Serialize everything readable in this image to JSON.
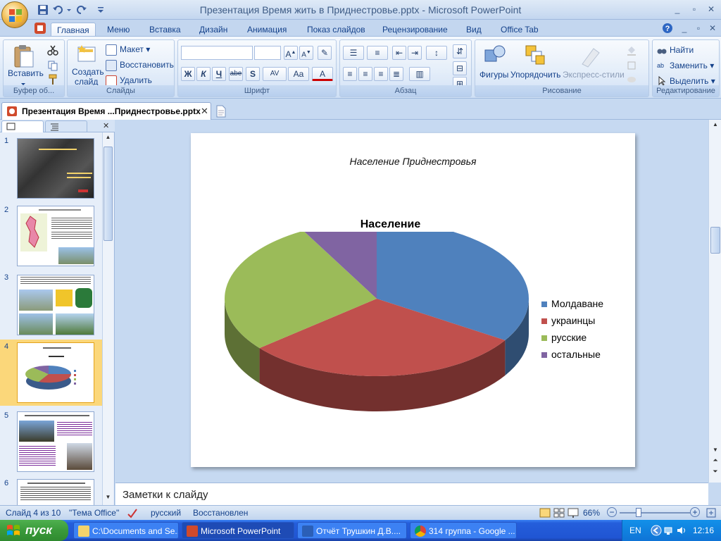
{
  "window": {
    "title": "Презентация  Время жить в Приднестровье.pptx - Microsoft PowerPoint",
    "controls": [
      "_",
      "▫",
      "✕"
    ]
  },
  "ribbon": {
    "tabs": [
      "Главная",
      "Меню",
      "Вставка",
      "Дизайн",
      "Анимация",
      "Показ слайдов",
      "Рецензирование",
      "Вид",
      "Office Tab"
    ],
    "active_tab": 0,
    "clipboard": {
      "paste": "Вставить",
      "label": "Буфер об..."
    },
    "slides": {
      "create": "Создать",
      "create2": "слайд",
      "layout": "Макет",
      "reset": "Восстановить",
      "delete": "Удалить",
      "label": "Слайды"
    },
    "font": {
      "label": "Шрифт",
      "bold": "Ж",
      "italic": "К",
      "underline": "Ч",
      "strike": "abe",
      "shadow": "S",
      "spacing": "AV",
      "case": "Aa",
      "color": "A",
      "grow": "A",
      "shrink": "A"
    },
    "paragraph": {
      "label": "Абзац"
    },
    "drawing": {
      "shapes": "Фигуры",
      "arrange": "Упорядочить",
      "styles": "Экспресс-стили",
      "label": "Рисование"
    },
    "editing": {
      "find": "Найти",
      "replace": "Заменить",
      "select": "Выделить",
      "label": "Редактирование"
    }
  },
  "document_tab": {
    "title": "Презентация  Время ...Приднестровье.pptx"
  },
  "thumbnails": [
    {
      "num": "1"
    },
    {
      "num": "2"
    },
    {
      "num": "3"
    },
    {
      "num": "4"
    },
    {
      "num": "5"
    },
    {
      "num": "6"
    }
  ],
  "slide": {
    "heading": "Население Приднестровья",
    "chart_title": "Население"
  },
  "chart_data": {
    "type": "pie",
    "title": "Население",
    "categories": [
      "Молдаване",
      "украинцы",
      "русские",
      "остальные"
    ],
    "values": [
      34,
      30,
      28,
      8
    ],
    "colors": [
      "#4f81bd",
      "#c0504d",
      "#9bbb59",
      "#8064a2"
    ],
    "legend": "right"
  },
  "notes": {
    "placeholder": "Заметки к слайду"
  },
  "status": {
    "slide": "Слайд 4 из 10",
    "theme": "\"Тема Office\"",
    "language": "русский",
    "restored": "Восстановлен",
    "zoom": "66%"
  },
  "taskbar": {
    "start": "пуск",
    "tasks": [
      "C:\\Documents and Se...",
      "Microsoft PowerPoint",
      "Отчёт Трушкин Д.В....",
      "314 группа - Google ..."
    ],
    "lang": "EN",
    "time": "12:16"
  }
}
